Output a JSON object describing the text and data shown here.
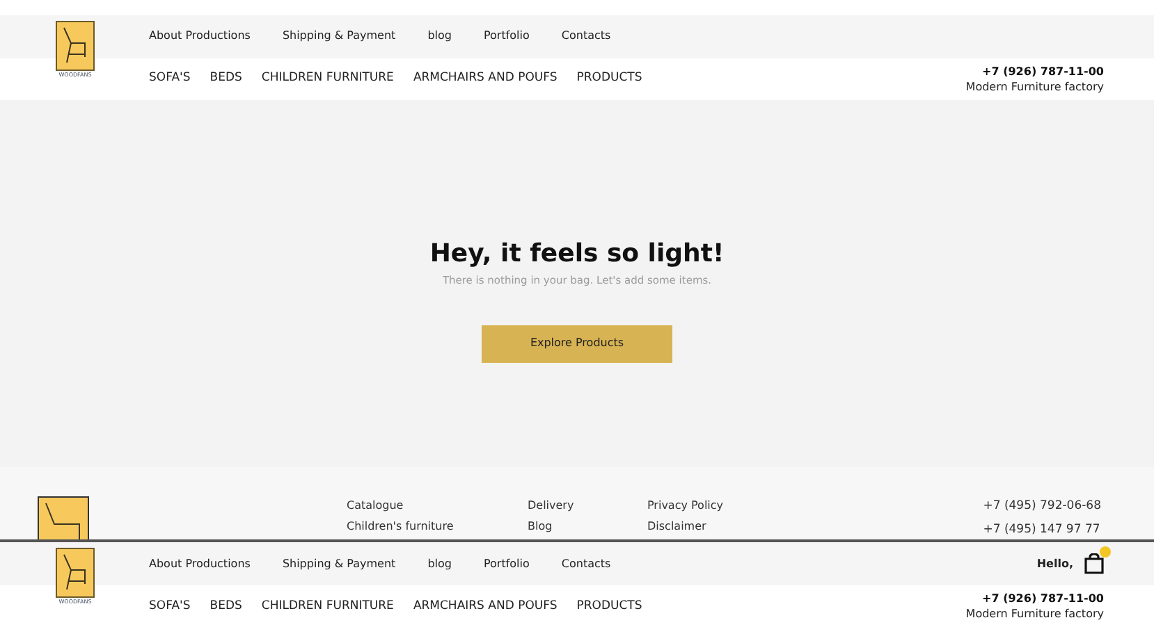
{
  "header": {
    "logo_caption": "WOODFANS",
    "top_links": [
      "About Productions",
      "Shipping & Payment",
      "blog",
      "Portfolio",
      "Contacts"
    ],
    "categories": [
      "SOFA'S",
      "BEDS",
      "CHILDREN FURNITURE",
      "ARMCHAIRS AND POUFS",
      "PRODUCTS"
    ],
    "phone": "+7 (926) 787-11-00",
    "tagline": "Modern Furniture factory"
  },
  "empty_bag": {
    "title": "Hey, it feels so light!",
    "message": "There is nothing in your bag. Let's add some items.",
    "button": "Explore Products"
  },
  "footer": {
    "columns": [
      [
        "Catalogue",
        "Children's furniture"
      ],
      [
        "Delivery",
        "Blog"
      ],
      [
        "Privacy Policy",
        "Disclaimer"
      ]
    ],
    "phones": [
      "+7 (495) 792-06-68",
      "+7 (495) 147 97 77"
    ]
  },
  "sticky_header": {
    "logo_caption": "WOODFANS",
    "top_links": [
      "About Productions",
      "Shipping & Payment",
      "blog",
      "Portfolio",
      "Contacts"
    ],
    "greeting": "Hello,",
    "cart_has_items": true,
    "categories": [
      "SOFA'S",
      "BEDS",
      "CHILDREN FURNITURE",
      "ARMCHAIRS AND POUFS",
      "PRODUCTS"
    ],
    "phone": "+7 (926) 787-11-00",
    "tagline": "Modern Furniture factory"
  }
}
